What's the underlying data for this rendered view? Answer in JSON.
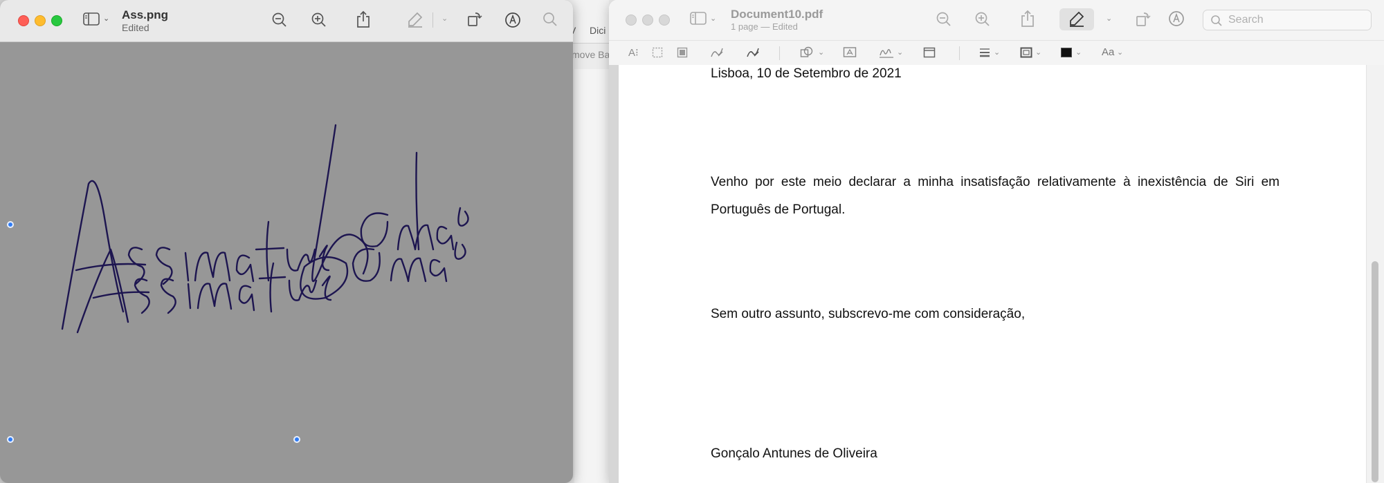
{
  "background": {
    "visible_menu_fragment": "Dici",
    "visible_toolbar_fragment": "V",
    "visible_fragment_2": "move Ba"
  },
  "left_window": {
    "file_name": "Ass.png",
    "status": "Edited",
    "signature_text": "Assinatura Gonçalo",
    "icons": [
      "sidebar-icon",
      "zoom-out-icon",
      "zoom-in-icon",
      "share-icon",
      "highlight-pen-icon",
      "rotate-icon",
      "markup-icon",
      "search-icon"
    ],
    "ink_color": "#1d1550"
  },
  "right_window": {
    "file_name": "Document10.pdf",
    "status": "1 page — Edited",
    "search_placeholder": "Search",
    "markup_font_label": "Aa",
    "document": {
      "date_line": "Lisboa, 10 de Setembro de 2021",
      "body_paragraph": "Venho por este meio declarar a minha insatisfação relativamente à inexistência de Siri em Português de Portugal.",
      "closing": "Sem outro assunto, subscrevo-me com consideração,",
      "signature_name": "Gonçalo Antunes de Oliveira"
    }
  }
}
